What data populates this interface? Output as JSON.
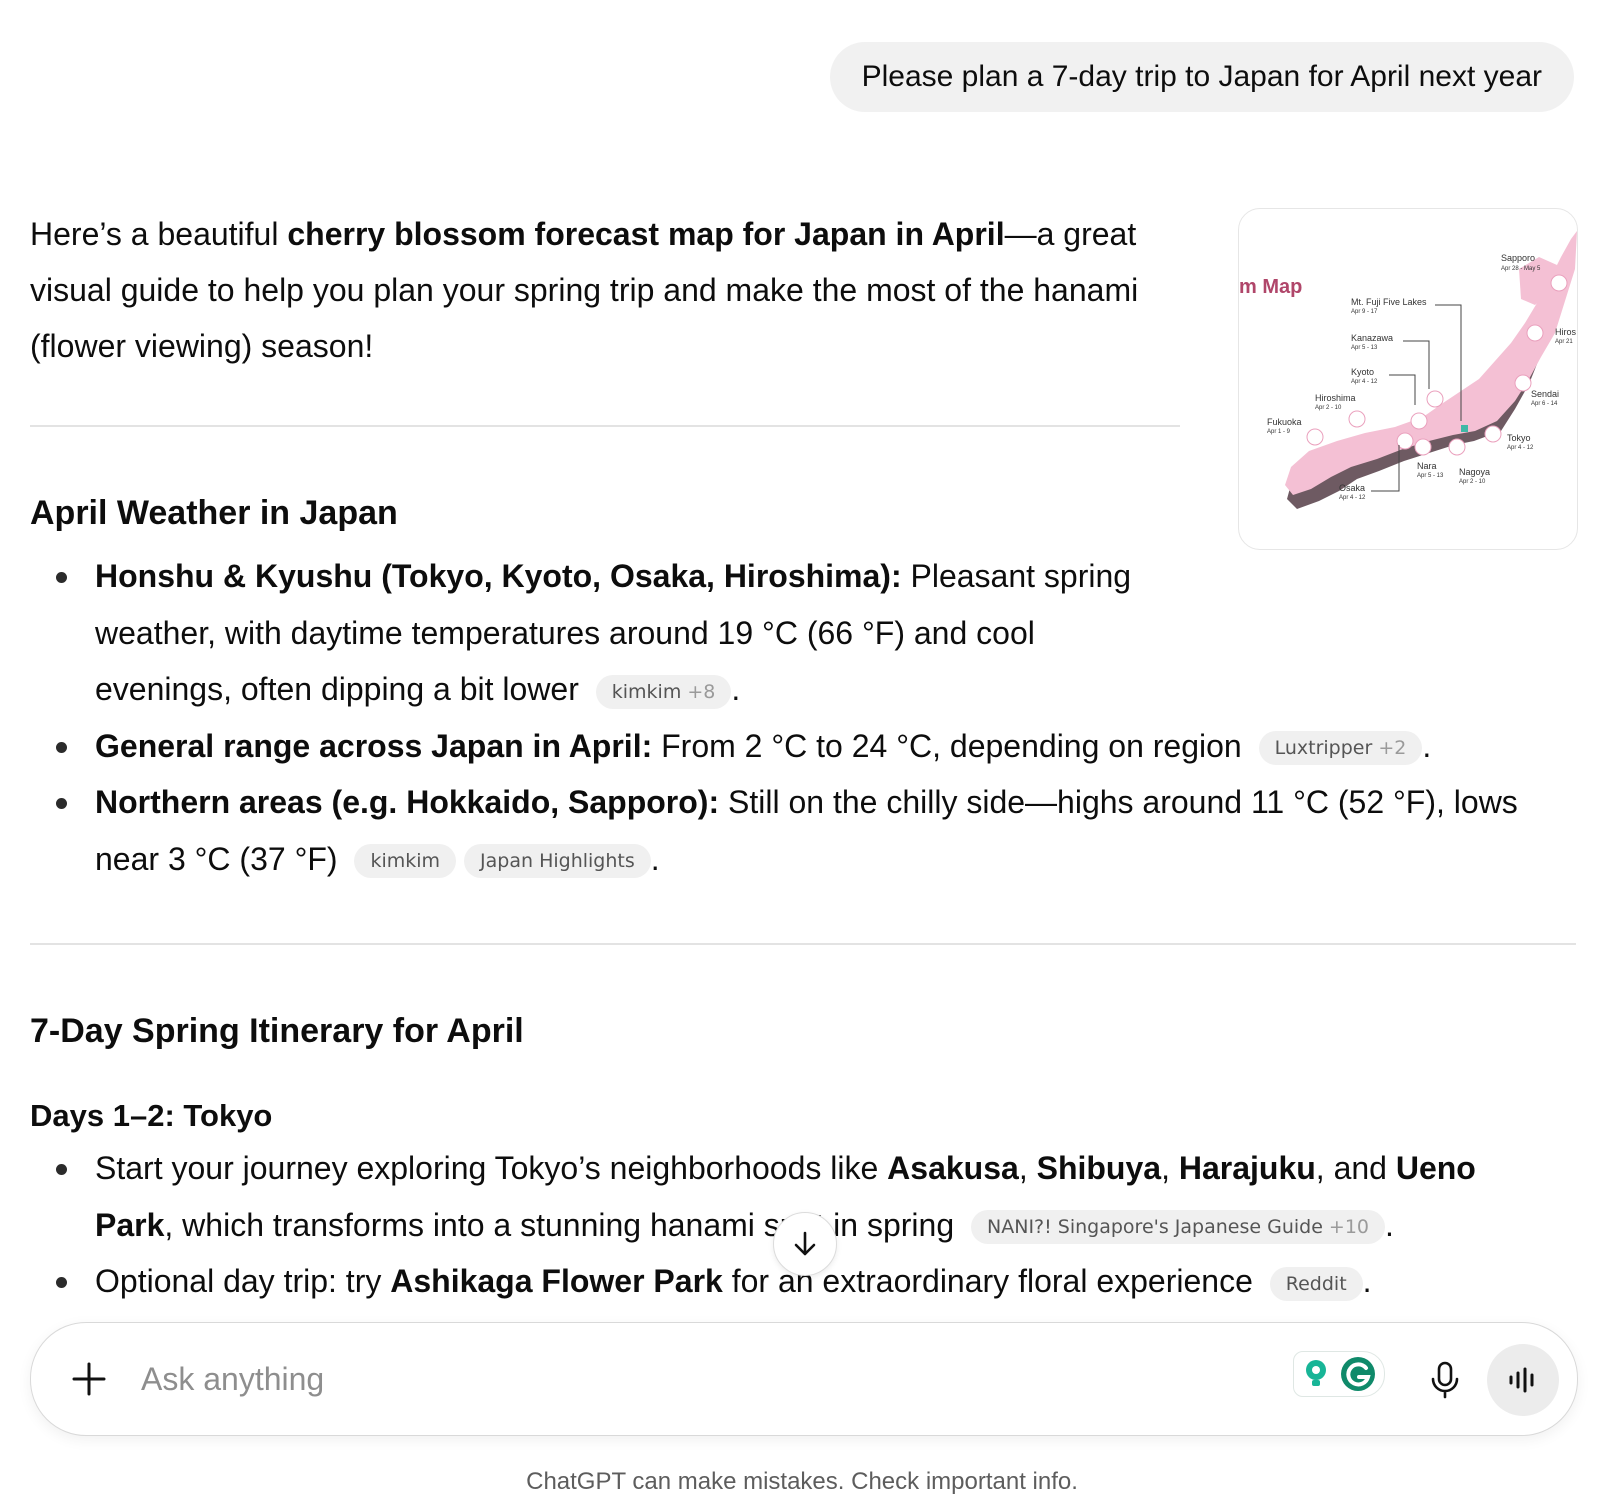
{
  "user_message": "Please plan a 7-day trip to Japan for April next year",
  "intro": {
    "pre": "Here’s a beautiful ",
    "bold": "cherry blossom forecast map for Japan in April",
    "post": "—a great visual guide to help you plan your spring trip and make the most of the hanami (flower viewing) season!"
  },
  "map_card": {
    "title": "m Map",
    "labels": [
      {
        "city": "Sapporo",
        "dates": "Apr 28 - May 5"
      },
      {
        "city": "Mt. Fuji Five Lakes",
        "dates": "Apr 9 - 17"
      },
      {
        "city": "Kanazawa",
        "dates": "Apr 5 - 13"
      },
      {
        "city": "Kyoto",
        "dates": "Apr 4 - 12"
      },
      {
        "city": "Hiroshima",
        "dates": "Apr 2 - 10"
      },
      {
        "city": "Fukuoka",
        "dates": "Apr 1 - 9"
      },
      {
        "city": "Osaka",
        "dates": "Apr 4 - 12"
      },
      {
        "city": "Nara",
        "dates": "Apr 5 - 13"
      },
      {
        "city": "Nagoya",
        "dates": "Apr 2 - 10"
      },
      {
        "city": "Tokyo",
        "dates": "Apr 4 - 12"
      },
      {
        "city": "Sendai",
        "dates": "Apr 6 - 14"
      },
      {
        "city": "Hiros",
        "dates": "Apr 21"
      }
    ]
  },
  "weather": {
    "heading": "April Weather in Japan",
    "items": [
      {
        "bold": "Honshu & Kyushu (Tokyo, Kyoto, Osaka, Hiroshima):",
        "text": " Pleasant spring weather, with daytime temperatures around 19 °C (66 °F) and cool evenings, often dipping a bit lower",
        "pill": "kimkim",
        "pill_more": "+8"
      },
      {
        "bold": "General range across Japan in April:",
        "text": " From 2 °C to 24 °C, depending on region",
        "pill": "Luxtripper",
        "pill_more": "+2"
      },
      {
        "bold": "Northern areas (e.g. Hokkaido, Sapporo):",
        "text": " Still on the chilly side—highs around 11 °C (52 °F), lows near 3 °C (37 °F)",
        "pill": "kimkim",
        "pill2": "Japan Highlights"
      }
    ]
  },
  "itinerary": {
    "heading": "7-Day Spring Itinerary for April",
    "day_heading": "Days 1–2: Tokyo",
    "item1": {
      "t1": "Start your journey exploring Tokyo’s neighborhoods like ",
      "b1": "Asakusa",
      "sep1": ", ",
      "b2": "Shibuya",
      "sep2": ", ",
      "b3": "Harajuku",
      "t2": ", and ",
      "b4": "Ueno Park",
      "t3": ", which transforms into a stunning hanami spot in spring",
      "pill": "NANI?! Singapore's Japanese Guide",
      "pill_more": "+10"
    },
    "item2": {
      "t1": "Optional day trip: try ",
      "b1": "Ashikaga Flower Park",
      "t2": " for an extraordinary floral experience",
      "pill": "Reddit"
    }
  },
  "composer": {
    "placeholder": "Ask anything"
  },
  "disclaimer": "ChatGPT can make mistakes. Check important info."
}
